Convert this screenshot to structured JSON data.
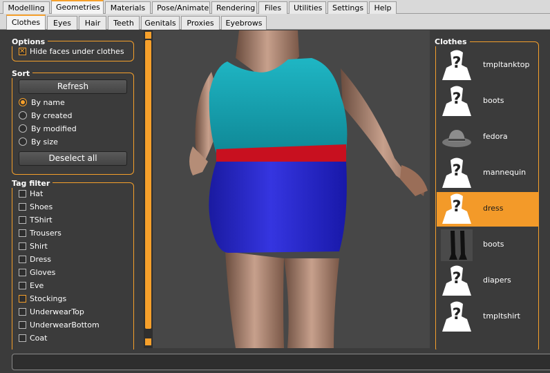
{
  "top_tabs": [
    "Modelling",
    "Geometries",
    "Materials",
    "Pose/Animate",
    "Rendering",
    "Files",
    "Utilities",
    "Settings",
    "Help"
  ],
  "sub_tabs": [
    "Clothes",
    "Eyes",
    "Hair",
    "Teeth",
    "Genitals",
    "Proxies",
    "Eyebrows"
  ],
  "options": {
    "title": "Options",
    "hide_faces_label": "Hide faces under clothes",
    "hide_faces_checked": true
  },
  "sort": {
    "title": "Sort",
    "refresh_label": "Refresh",
    "radios": [
      {
        "label": "By name",
        "checked": true
      },
      {
        "label": "By created",
        "checked": false
      },
      {
        "label": "By modified",
        "checked": false
      },
      {
        "label": "By size",
        "checked": false
      }
    ],
    "deselect_label": "Deselect all"
  },
  "tag_filter": {
    "title": "Tag filter",
    "tags": [
      "Hat",
      "Shoes",
      "TShirt",
      "Trousers",
      "Shirt",
      "Dress",
      "Gloves",
      "Eve",
      "Stockings",
      "UnderwearTop",
      "UnderwearBottom",
      "Coat"
    ]
  },
  "clothes": {
    "title": "Clothes",
    "items": [
      {
        "label": "tmpltanktop",
        "selected": false,
        "icon": "unknown-figure-icon"
      },
      {
        "label": "boots",
        "selected": false,
        "icon": "unknown-figure-icon"
      },
      {
        "label": "fedora",
        "selected": false,
        "icon": "fedora-icon"
      },
      {
        "label": "mannequin",
        "selected": false,
        "icon": "unknown-figure-icon"
      },
      {
        "label": "dress",
        "selected": true,
        "icon": "unknown-figure-icon"
      },
      {
        "label": "boots",
        "selected": false,
        "icon": "boots-icon"
      },
      {
        "label": "diapers",
        "selected": false,
        "icon": "unknown-figure-icon"
      },
      {
        "label": "tmpltshirt",
        "selected": false,
        "icon": "unknown-figure-icon"
      }
    ]
  },
  "colors": {
    "accent": "#f6a02b",
    "top": "#17a5b3",
    "belt": "#cc1022",
    "skirt": "#2222c8"
  }
}
